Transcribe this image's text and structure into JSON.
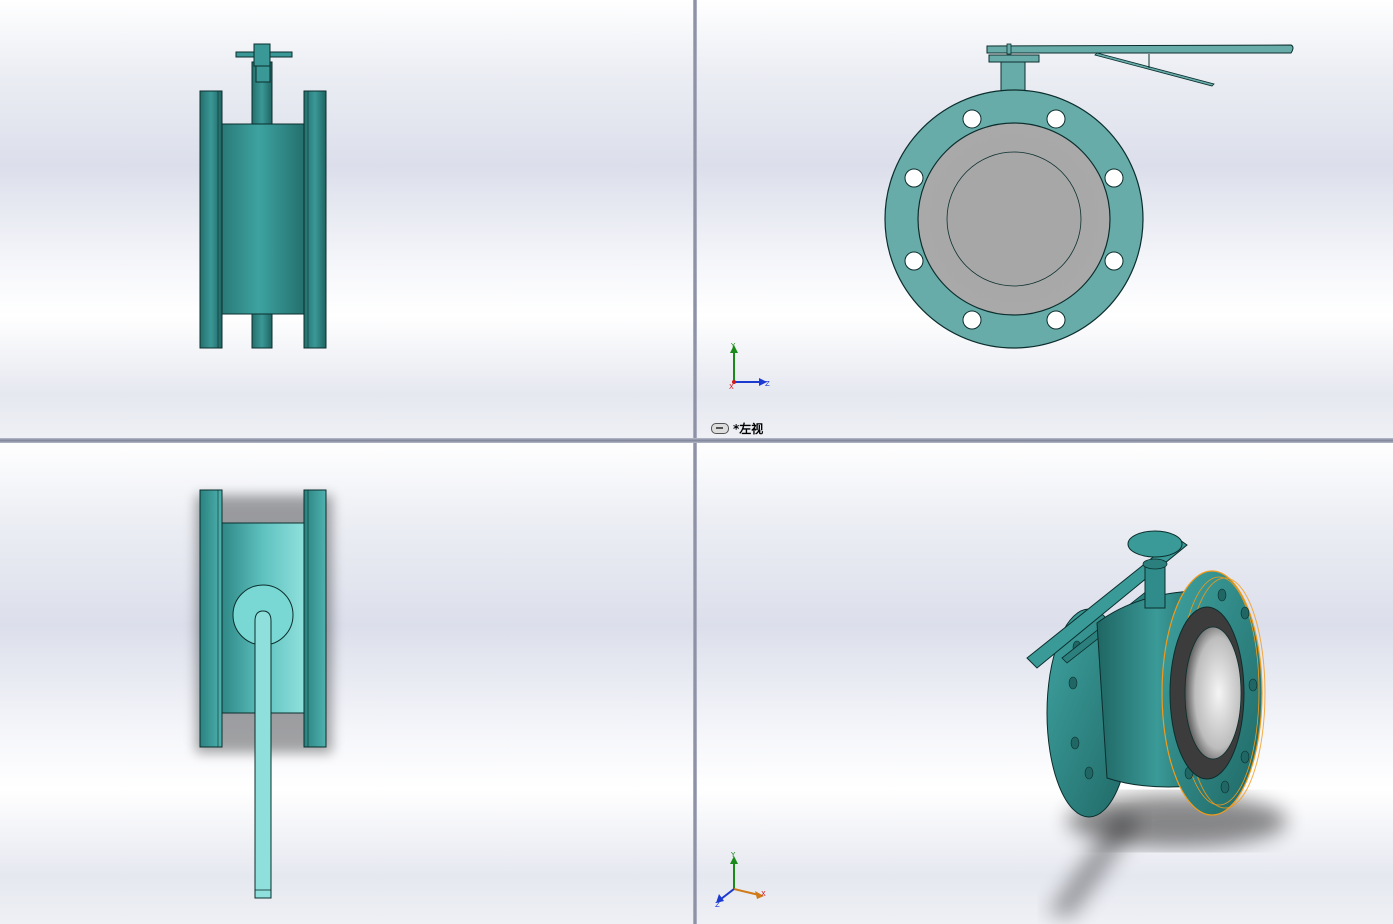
{
  "app": {
    "window_title": "",
    "layout": "four-viewport"
  },
  "viewports": [
    {
      "id": "top-left",
      "content": "butterfly-valve-top-view",
      "active": false
    },
    {
      "id": "top-right",
      "content": "butterfly-valve-left-view",
      "active": true,
      "label": "*左视",
      "triad_axes": [
        "Y",
        "X",
        "Z"
      ]
    },
    {
      "id": "bottom-left",
      "content": "butterfly-valve-front-view",
      "active": false
    },
    {
      "id": "bottom-right",
      "content": "butterfly-valve-isometric-view",
      "active": false,
      "triad_axes": [
        "Y",
        "Z",
        "X"
      ]
    }
  ],
  "colors": {
    "body_teal": "#2f8c8a",
    "body_teal_light": "#6fb5b3",
    "flange_face": "#68acaa",
    "liner_gray": "#a8a8a8",
    "selection_orange": "#f39a1a",
    "axis_y": "#1a8a1a",
    "axis_x": "#d01818",
    "axis_z": "#1a3ad0"
  }
}
